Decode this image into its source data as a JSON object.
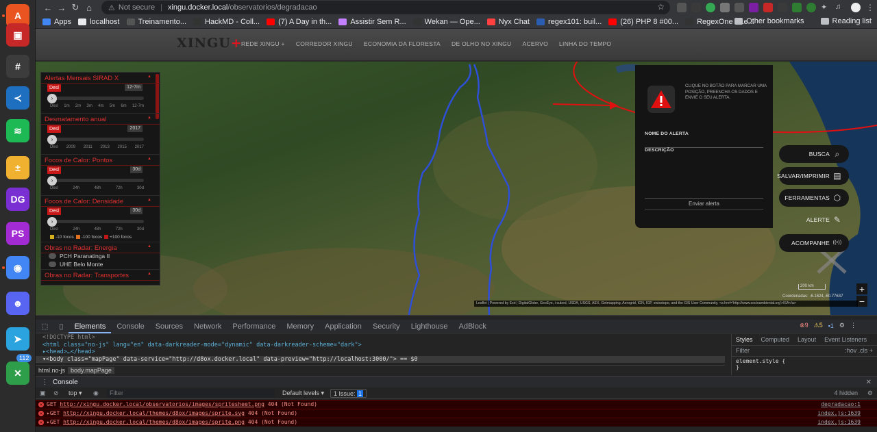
{
  "browser": {
    "url_prefix": "Not secure",
    "url_host": "xingu.docker.local",
    "url_path": "/observatorios/degradacao",
    "bookmarks": [
      {
        "label": "Apps",
        "color": "#4285f4"
      },
      {
        "label": "localhost",
        "color": "#e8eaed"
      },
      {
        "label": "Treinamento...",
        "color": "#555555"
      },
      {
        "label": "HackMD - Coll...",
        "color": "#333333"
      },
      {
        "label": "(7) A Day in th...",
        "color": "#ff0000"
      },
      {
        "label": "Assistir Sem R...",
        "color": "#c080ff"
      },
      {
        "label": "Wekan — Ope...",
        "color": "#333333"
      },
      {
        "label": "Nyx Chat",
        "color": "#ff4040"
      },
      {
        "label": "regex101: buil...",
        "color": "#2a5db0"
      },
      {
        "label": "(26) PHP 8 #00...",
        "color": "#ff0000"
      },
      {
        "label": "RegexOne - Le...",
        "color": "#333333"
      }
    ],
    "other_bookmarks": "Other bookmarks",
    "reading_list": "Reading list"
  },
  "dock": {
    "items": [
      {
        "name": "app-center",
        "color": "#e95420",
        "glyph": "A"
      },
      {
        "name": "screenshot-tool",
        "color": "#c62828",
        "glyph": "▣"
      },
      {
        "name": "slack",
        "color": "#3c3c3c",
        "glyph": "#"
      },
      {
        "name": "vscode",
        "color": "#1e6fbf",
        "glyph": "≺"
      },
      {
        "name": "spotify",
        "color": "#1db954",
        "glyph": "≋"
      },
      {
        "name": "calculator",
        "color": "#f0b030",
        "glyph": "±"
      },
      {
        "name": "datagrip",
        "color": "#7a2fd3",
        "glyph": "DG"
      },
      {
        "name": "phpstorm",
        "color": "#a22bd4",
        "glyph": "PS"
      },
      {
        "name": "chrome",
        "color": "#4285f4",
        "glyph": "◉"
      },
      {
        "name": "discord",
        "color": "#5865f2",
        "glyph": "☻"
      },
      {
        "name": "telegram",
        "color": "#2aa3df",
        "glyph": "➤"
      },
      {
        "name": "crossover",
        "color": "#2e9e4a",
        "glyph": "✕"
      }
    ],
    "telegram_badge": "112"
  },
  "site": {
    "logo": "XINGU",
    "logo_mark": "+",
    "nav": [
      "REDE XINGU +",
      "CORREDOR XINGU",
      "ECONOMIA DA FLORESTA",
      "DE OLHO NO XINGU",
      "ACERVO",
      "LINHA DO TEMPO"
    ]
  },
  "sidebar": {
    "sections": [
      {
        "title": "Alertas Mensais SIRAD X",
        "button": "Desl",
        "value": "12-7m",
        "ticks": [
          "Desl",
          "1m",
          "2m",
          "3m",
          "4m",
          "5m",
          "6m",
          "12-7m"
        ]
      },
      {
        "title": "Desmatamento anual",
        "button": "Desl",
        "value": "2017",
        "ticks": [
          "Desl",
          "2009",
          "2011",
          "2013",
          "2015",
          "2017"
        ]
      },
      {
        "title": "Focos de Calor: Pontos",
        "button": "Desl",
        "value": "30d",
        "ticks": [
          "Desl",
          "24h",
          "48h",
          "72h",
          "30d"
        ]
      },
      {
        "title": "Focos de Calor: Densidade",
        "button": "Desl",
        "value": "30d",
        "ticks": [
          "Desl",
          "24h",
          "48h",
          "72h",
          "30d"
        ]
      }
    ],
    "legend": [
      "-10 focos",
      "-100 focos",
      "+100 focos"
    ],
    "legend_colors": [
      "#d4b020",
      "#e07020",
      "#c01818"
    ],
    "radar_energy": {
      "title": "Obras no Radar: Energia",
      "items": [
        "PCH Paranatinga II",
        "UHE Belo Monte"
      ]
    },
    "radar_transport": {
      "title": "Obras no Radar: Transportes"
    }
  },
  "alert_panel": {
    "message": "CLIQUE NO BOTÃO PARA MARCAR UMA POSIÇÃO, PREENCHA OS DADOS E ENVIE O SEU ALERTA.",
    "name_label": "NOME DO ALERTA",
    "desc_label": "DESCRIÇÃO",
    "send": "Enviar alerta"
  },
  "map_buttons": [
    {
      "label": "BUSCA",
      "icon": "search-icon",
      "glyph": "⌕"
    },
    {
      "label": "SALVAR/IMPRIMIR",
      "icon": "print-icon",
      "glyph": "▤"
    },
    {
      "label": "FERRAMENTAS",
      "icon": "tools-icon",
      "glyph": "⬡"
    },
    {
      "label": "ALERTE",
      "icon": "pen-icon",
      "glyph": "✎"
    },
    {
      "label": "ACOMPANHE",
      "icon": "broadcast-icon",
      "glyph": "((•))"
    }
  ],
  "map": {
    "zoom_in": "+",
    "zoom_out": "−",
    "scale": "200 km",
    "coords": "Coordenadas: -6.1624,-60.77637",
    "attribution": "Leaflet | Powered by Esri | DigitalGlobe, GeoEye, i-cubed, USDA, USGS, AEX, Getmapping, Aerogrid, IGN, IGP, swisstopo, and the GIS User Community, <a href='http://www.socioambiental.org'>ISA</a>"
  },
  "devtools": {
    "tabs": [
      "Elements",
      "Console",
      "Sources",
      "Network",
      "Performance",
      "Memory",
      "Application",
      "Security",
      "Lighthouse",
      "AdBlock"
    ],
    "errors_count": "9",
    "warnings_count": "5",
    "issues_count": "1",
    "code_lines": [
      "<!DOCTYPE html>",
      "<html class=\"no-js\" lang=\"en\" data-darkreader-mode=\"dynamic\" data-darkreader-scheme=\"dark\">",
      "▸<head>…</head>",
      "▾<body class=\"mapPage\" data-service=\"http://d8ox.docker.local\" data-preview=\"http://localhost:3000/\"> == $0"
    ],
    "breadcrumbs": [
      "html.no-js",
      "body.mapPage"
    ],
    "styles_tabs": [
      "Styles",
      "Computed",
      "Layout",
      "Event Listeners"
    ],
    "filter_placeholder": "Filter",
    "hov": ":hov",
    "cls": ".cls",
    "element_style": "element.style {",
    "element_style_close": "}",
    "console_title": "Console",
    "context": "top",
    "levels": "Default levels",
    "issue_badge": "1 Issue:",
    "issue_num": "1",
    "hidden": "4 hidden",
    "errors": [
      {
        "text": "GET ",
        "url": "http://xingu.docker.local/observatorios/images/spritesheet.png",
        "status": " 404 (Not Found)",
        "src": "degradacao:1"
      },
      {
        "text": "▸GET ",
        "url": "http://xingu.docker.local/themes/d8ox/images/sprite.svg",
        "status": " 404 (Not Found)",
        "src": "index.js:1639"
      },
      {
        "text": "▸GET ",
        "url": "http://xingu.docker.local/themes/d8ox/images/sprite.png",
        "status": " 404 (Not Found)",
        "src": "index.js:1639"
      }
    ]
  }
}
